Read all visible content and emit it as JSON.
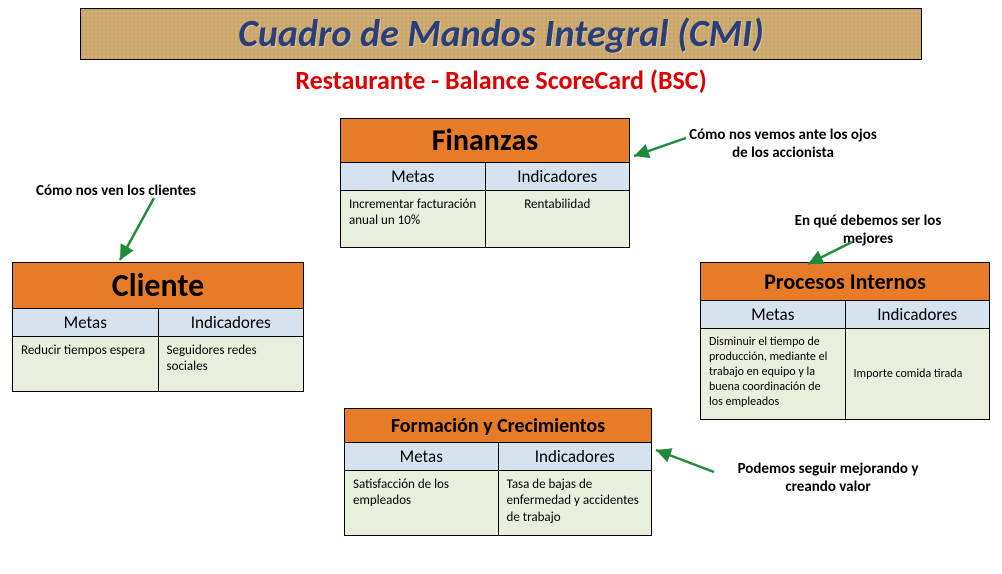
{
  "title": "Cuadro de Mandos Integral (CMI)",
  "subtitle": "Restaurante - Balance ScoreCard (BSC)",
  "columns": {
    "metas": "Metas",
    "indicadores": "Indicadores"
  },
  "box": {
    "finanzas": {
      "title": "Finanzas",
      "meta": "Incrementar facturación anual un 10%",
      "indicador": "Rentabilidad",
      "annotation": "Cómo nos vemos ante los ojos de los accionista"
    },
    "cliente": {
      "title": "Cliente",
      "meta": "Reducir tiempos espera",
      "indicador": "Seguidores redes sociales",
      "annotation": "Cómo nos ven los clientes"
    },
    "procesos": {
      "title": "Procesos Internos",
      "meta": "Disminuir el tiempo de producción, mediante el trabajo en equipo y la buena coordinación de los empleados",
      "indicador": "Importe comida tirada",
      "annotation": "En qué debemos ser los mejores"
    },
    "formacion": {
      "title": "Formación y Crecimientos",
      "meta": "Satisfacción de los empleados",
      "indicador": "Tasa de bajas de enfermedad y accidentes de trabajo",
      "annotation": "Podemos seguir mejorando y creando valor"
    }
  },
  "colors": {
    "header_orange": "#e87b28",
    "subhead_blue": "#d6e2ee",
    "body_green": "#e8efdc",
    "arrow_green": "#1f8a3b",
    "subtitle_red": "#e00000",
    "title_blue": "#2a3f7a"
  }
}
